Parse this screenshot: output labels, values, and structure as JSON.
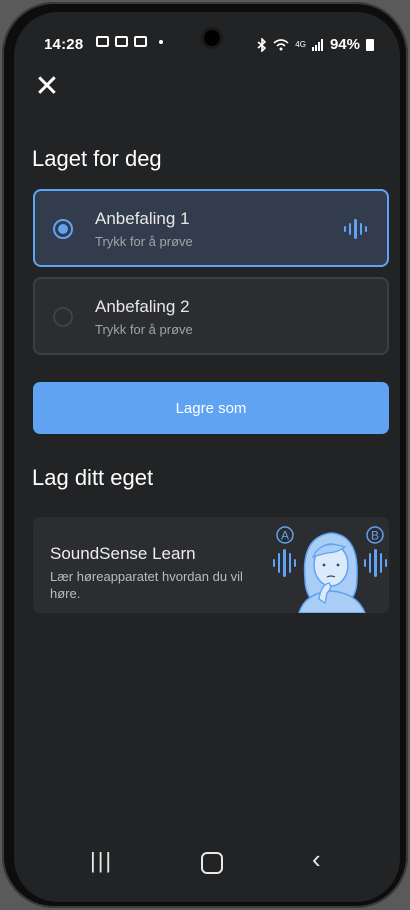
{
  "status_bar": {
    "time": "14:28",
    "battery": "94%",
    "network": "4G"
  },
  "header": {
    "close_icon": "close-icon"
  },
  "section_made_for_you": {
    "title": "Laget for deg",
    "options": [
      {
        "title": "Anbefaling 1",
        "subtitle": "Trykk for å prøve",
        "selected": true
      },
      {
        "title": "Anbefaling 2",
        "subtitle": "Trykk for å prøve",
        "selected": false
      }
    ]
  },
  "save_button": {
    "label": "Lagre som"
  },
  "section_create_own": {
    "title": "Lag ditt eget",
    "card": {
      "title": "SoundSense Learn",
      "description": "Lær høreapparatet hvordan du vil høre.",
      "label_a": "A",
      "label_b": "B"
    }
  },
  "colors": {
    "accent": "#5fa3f2",
    "background": "#222325",
    "card": "#2b2d30",
    "selected_card": "#333c4c"
  },
  "nav": {
    "recent_icon": "recent-apps-icon",
    "home_icon": "home-icon",
    "back_icon": "back-icon"
  }
}
